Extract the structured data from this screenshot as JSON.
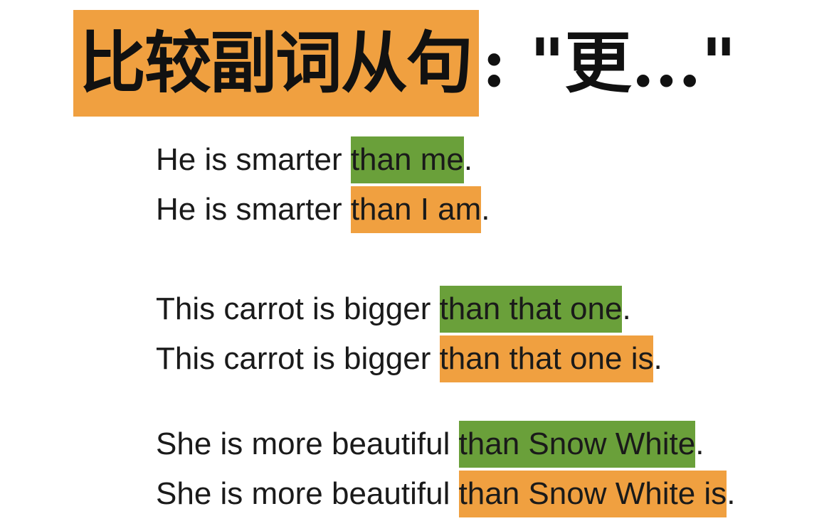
{
  "title": {
    "highlighted": "比较副词从句",
    "rest": ": \"更...\""
  },
  "colors": {
    "green": "#6aa03a",
    "orange": "#f0a040"
  },
  "sentences": [
    {
      "prefix": "He is smarter ",
      "highlight": "than me",
      "suffix": ".",
      "color": "green"
    },
    {
      "prefix": "He is smarter ",
      "highlight": "than I am",
      "suffix": ".",
      "color": "orange"
    },
    {
      "prefix": "This carrot is bigger ",
      "highlight": "than that one",
      "suffix": ".",
      "color": "green"
    },
    {
      "prefix": "This carrot is bigger ",
      "highlight": "than that one is",
      "suffix": ".",
      "color": "orange"
    },
    {
      "prefix": "She is more beautiful ",
      "highlight": "than Snow White",
      "suffix": ".",
      "color": "green"
    },
    {
      "prefix": "She is more beautiful ",
      "highlight": "than Snow White is",
      "suffix": ".",
      "color": "orange"
    }
  ]
}
